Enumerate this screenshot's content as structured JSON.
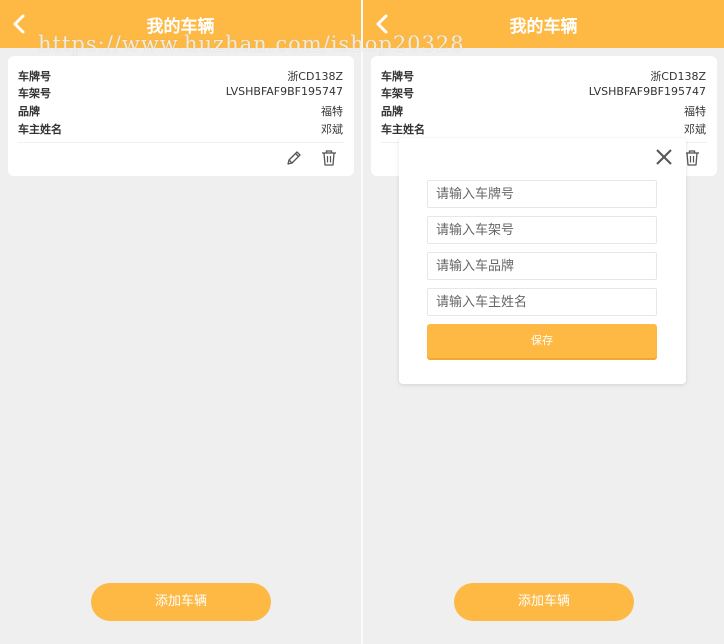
{
  "header": {
    "title": "我的车辆"
  },
  "watermark": "https://www.huzhan.com/ishop20328",
  "vehicle": {
    "fields": [
      {
        "label": "车牌号",
        "value": "浙CD138Z"
      },
      {
        "label": "车架号",
        "value": "LVSHBFAF9BF195747"
      },
      {
        "label": "品牌",
        "value": "福特"
      },
      {
        "label": "车主姓名",
        "value": "邓斌"
      }
    ]
  },
  "modal": {
    "plate_placeholder": "请输入车牌号",
    "vin_placeholder": "请输入车架号",
    "brand_placeholder": "请输入车品牌",
    "owner_placeholder": "请输入车主姓名",
    "save_label": "保存"
  },
  "add_button_label": "添加车辆",
  "colors": {
    "accent": "#fdb944",
    "background": "#efefef"
  },
  "icons": {
    "back": "chevron-left-icon",
    "edit": "pencil-icon",
    "delete": "trash-icon",
    "close": "close-icon"
  }
}
